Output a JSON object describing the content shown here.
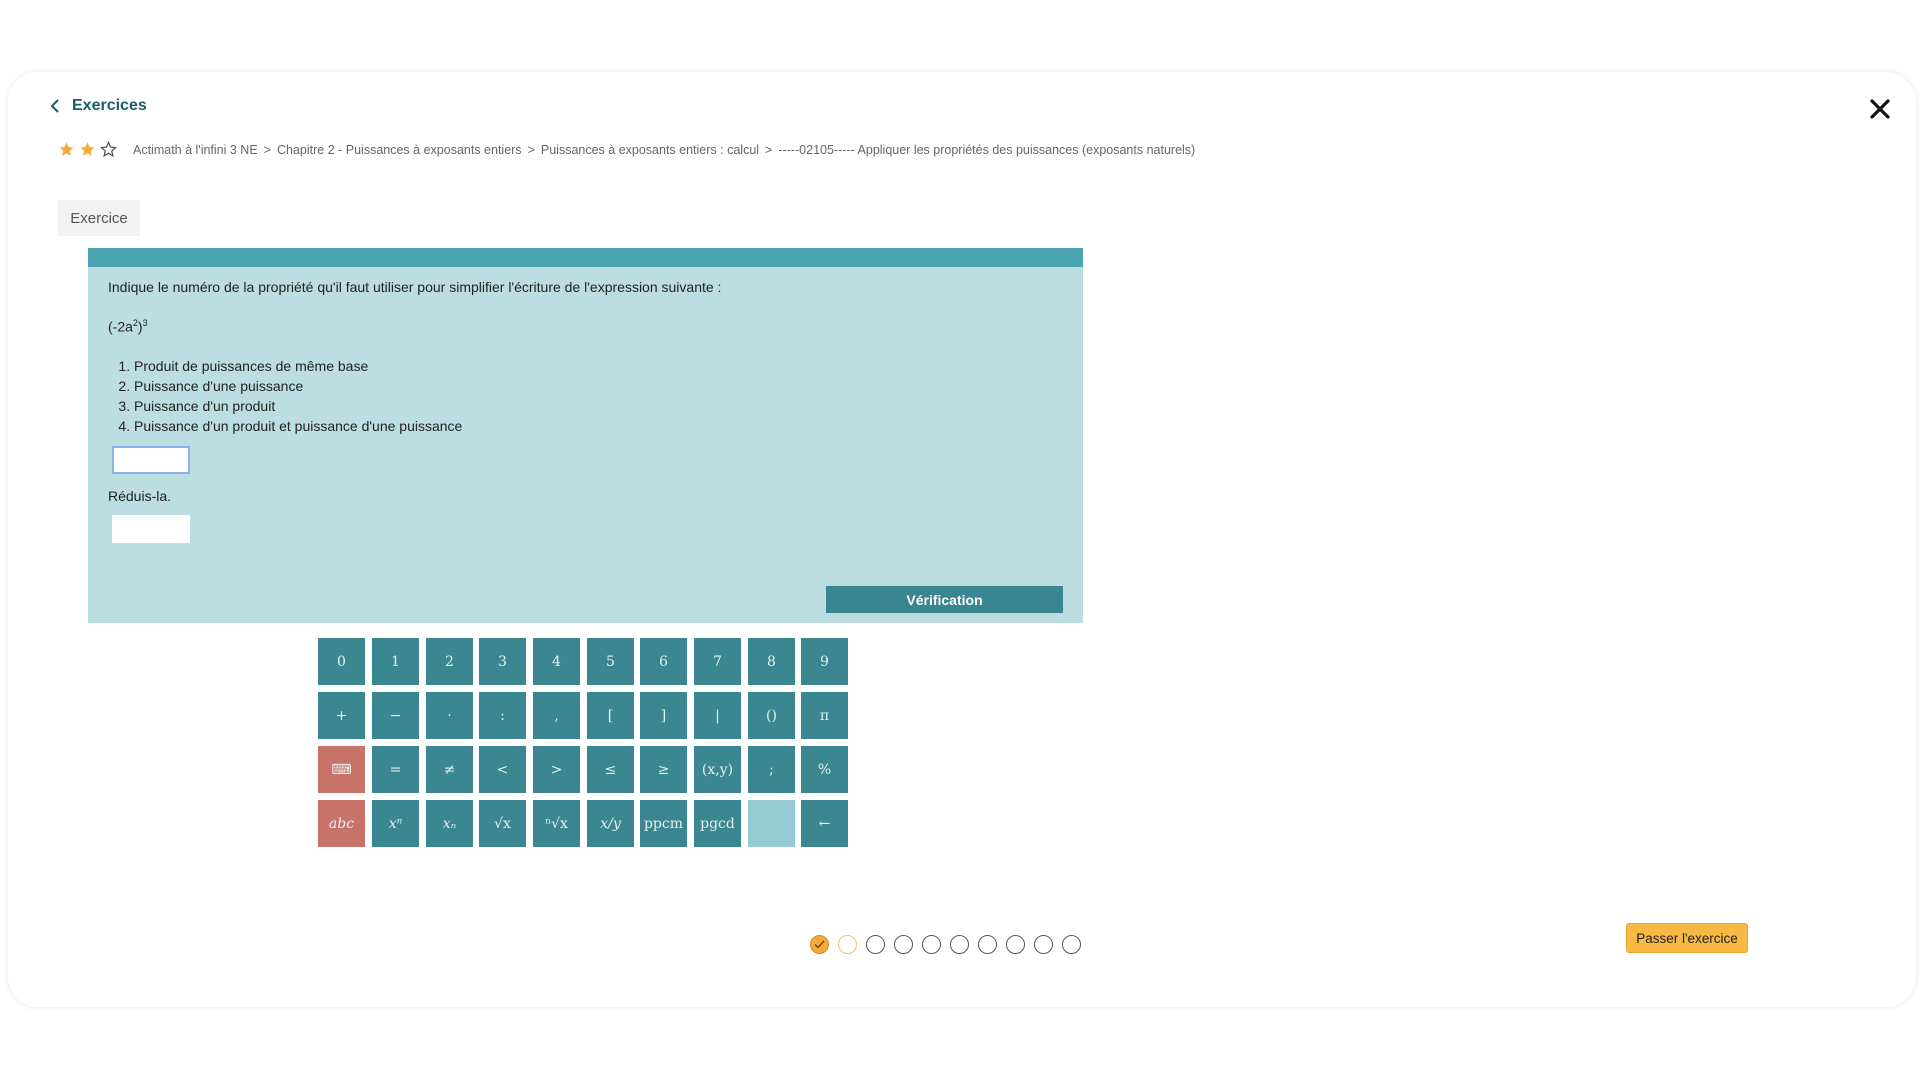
{
  "header": {
    "back_label": "Exercices",
    "stars_filled": 2,
    "stars_total": 3,
    "breadcrumbs": [
      "Actimath à l'infini 3 NE",
      "Chapitre 2 - Puissances à exposants entiers",
      "Puissances à exposants entiers : calcul",
      "-----02105----- Appliquer les propriétés des puissances (exposants naturels)"
    ],
    "separator": ">"
  },
  "tab": {
    "label": "Exercice"
  },
  "exercise": {
    "question": "Indique le numéro de la propriété qu'il faut utiliser pour simplifier l'écriture de l'expression suivante :",
    "expression": {
      "prefix": "(-2a",
      "inner_exp": "2",
      "middle": ")",
      "outer_exp": "3"
    },
    "properties": [
      "Produit de puissances de même base",
      "Puissance d'une puissance",
      "Puissance d'un produit",
      "Puissance d'un produit et puissance d'une puissance"
    ],
    "answer1_value": "",
    "reduce_label": "Réduis-la.",
    "answer2_value": "",
    "verify_label": "Vérification"
  },
  "keypad": {
    "rows": [
      [
        "0",
        "1",
        "2",
        "3",
        "4",
        "5",
        "6",
        "7",
        "8",
        "9"
      ],
      [
        "+",
        "−",
        "·",
        ":",
        ",",
        "[",
        "]",
        "|",
        "()",
        "π"
      ],
      [
        "⌨",
        "=",
        "≠",
        "<",
        ">",
        "≤",
        "≥",
        "(x,y)",
        ";",
        "%"
      ],
      [
        "abc",
        "xⁿ",
        "xₙ",
        "√x",
        "ⁿ√x",
        "x/y",
        "ppcm",
        "pgcd",
        "",
        "←"
      ]
    ],
    "colors": {
      "key": "#3b8791",
      "special": "#c8736a",
      "blank": "#94cad3"
    }
  },
  "progress": {
    "total": 10,
    "completed": 1,
    "current": 2
  },
  "skip_label": "Passer l'exercice",
  "colors": {
    "accent": "#1a5f66",
    "panel": "#bcdde2",
    "panel_header": "#4aa3b0",
    "verify_button": "#3a8592",
    "skip_button": "#f8b844",
    "star": "#f5a93a"
  }
}
